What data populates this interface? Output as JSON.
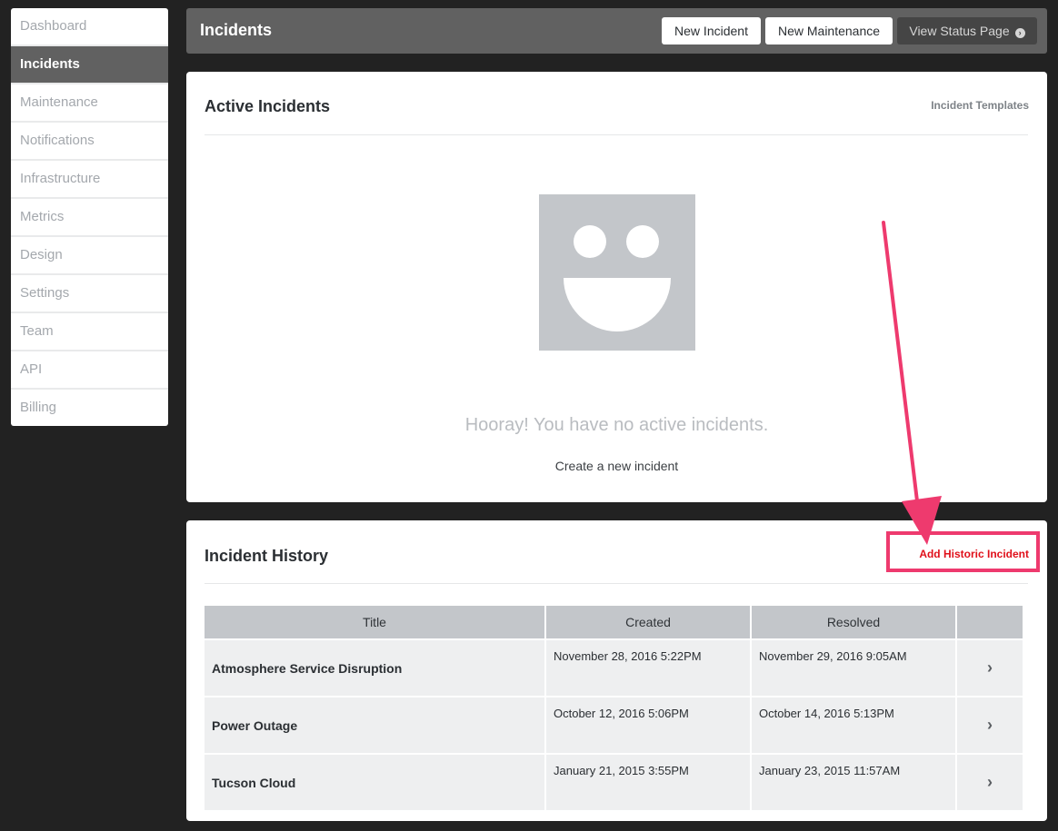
{
  "sidebar": {
    "items": [
      {
        "label": "Dashboard"
      },
      {
        "label": "Incidents"
      },
      {
        "label": "Maintenance"
      },
      {
        "label": "Notifications"
      },
      {
        "label": "Infrastructure"
      },
      {
        "label": "Metrics"
      },
      {
        "label": "Design"
      },
      {
        "label": "Settings"
      },
      {
        "label": "Team"
      },
      {
        "label": "API"
      },
      {
        "label": "Billing"
      }
    ],
    "active": "Incidents"
  },
  "header": {
    "title": "Incidents",
    "new_incident_label": "New Incident",
    "new_maintenance_label": "New Maintenance",
    "view_status_page_label": "View Status Page"
  },
  "active_incidents": {
    "title": "Active Incidents",
    "templates_link": "Incident Templates",
    "empty_message": "Hooray! You have no active incidents.",
    "create_link": "Create a new incident"
  },
  "incident_history": {
    "title": "Incident History",
    "add_historic_link": "Add Historic Incident",
    "columns": [
      "Title",
      "Created",
      "Resolved",
      ""
    ],
    "rows": [
      {
        "title": "Atmosphere Service Disruption",
        "created": "November 28, 2016 5:22PM",
        "resolved": "November 29, 2016 9:05AM"
      },
      {
        "title": "Power Outage",
        "created": "October 12, 2016 5:06PM",
        "resolved": "October 14, 2016 5:13PM"
      },
      {
        "title": "Tucson Cloud",
        "created": "January 21, 2015 3:55PM",
        "resolved": "January 23, 2015 11:57AM"
      }
    ]
  },
  "colors": {
    "sidebar_active_bg": "#616161",
    "header_bg": "#616161",
    "page_bg": "#222222",
    "annotation": "#ee3a6e",
    "link_red": "#e0101a"
  },
  "icons": {
    "row_open": "chevron-right-icon",
    "view_status_page": "arrow-circle-right-icon",
    "empty_state": "smiley-face-icon"
  }
}
